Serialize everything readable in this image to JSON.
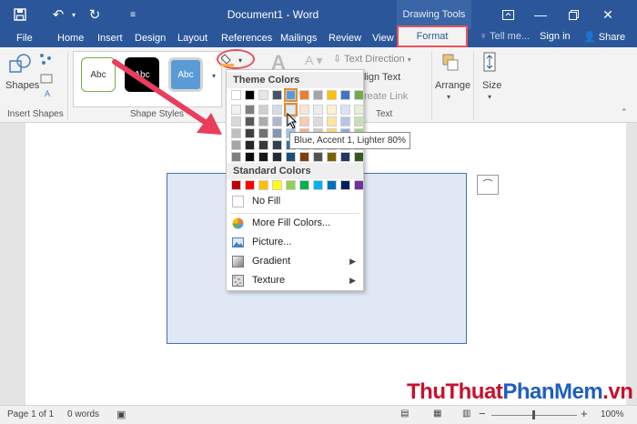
{
  "titlebar": {
    "doc_title": "Document1 - Word",
    "contextual_label": "Drawing Tools"
  },
  "tabs": [
    "File",
    "Home",
    "Insert",
    "Design",
    "Layout",
    "References",
    "Mailings",
    "Review",
    "View"
  ],
  "format_tab": "Format",
  "tell_me": "Tell me...",
  "sign_in": "Sign in",
  "share": "Share",
  "ribbon": {
    "shapes_label": "Shapes",
    "insert_shapes_group": "Insert Shapes",
    "shape_styles_group": "Shape Styles",
    "style_samples": [
      "Abc",
      "Abc",
      "Abc"
    ],
    "text_direction": "Text Direction",
    "align_text": "lign Text",
    "create_link": "reate Link",
    "text_group": "Text",
    "arrange": "Arrange",
    "size": "Size"
  },
  "fill_menu": {
    "theme_colors_header": "Theme Colors",
    "standard_colors_header": "Standard Colors",
    "no_fill": "No Fill",
    "more_fill_colors": "More Fill Colors...",
    "picture": "Picture...",
    "gradient": "Gradient",
    "texture": "Texture",
    "theme_top_row": [
      "#ffffff",
      "#000000",
      "#e7e6e6",
      "#44546a",
      "#5b9bd5",
      "#ed7d31",
      "#a5a5a5",
      "#ffc000",
      "#4472c4",
      "#70ad47"
    ],
    "theme_shades": [
      [
        "#f2f2f2",
        "#7f7f7f",
        "#d0cece",
        "#d6dce4",
        "#deebf6",
        "#fbe5d5",
        "#ededed",
        "#fff2cc",
        "#dae3f3",
        "#e2efd9"
      ],
      [
        "#d8d8d8",
        "#595959",
        "#aeabab",
        "#adb9ca",
        "#bdd7ee",
        "#f7cbac",
        "#dbdbdb",
        "#fee599",
        "#b4c6e7",
        "#c5e0b3"
      ],
      [
        "#bfbfbf",
        "#3f3f3f",
        "#757070",
        "#8496b0",
        "#9cc3e5",
        "#f4b183",
        "#c9c9c9",
        "#ffd965",
        "#8eaadb",
        "#a8d08d"
      ],
      [
        "#a5a5a5",
        "#262626",
        "#3a3838",
        "#323f4f",
        "#2e75b5",
        "#c55a11",
        "#7b7b7b",
        "#bf9000",
        "#2f5496",
        "#538135"
      ],
      [
        "#7f7f7f",
        "#0c0c0c",
        "#171616",
        "#222a35",
        "#1e4e79",
        "#833c0b",
        "#525252",
        "#7f6000",
        "#1f3864",
        "#375623"
      ]
    ],
    "standard_colors": [
      "#c00000",
      "#ff0000",
      "#ffc000",
      "#ffff00",
      "#92d050",
      "#00b050",
      "#00b0f0",
      "#0070c0",
      "#002060",
      "#7030a0"
    ]
  },
  "tooltip": "Blue, Accent 1, Lighter 80%",
  "status": {
    "page": "Page 1 of 1",
    "words": "0 words",
    "zoom": "100%"
  },
  "watermark": {
    "part1": "ThuThuat",
    "part2": "PhanMem",
    "part3": ".vn"
  },
  "colors": {
    "word_blue": "#2b579a",
    "highlight_red": "#e8525a",
    "shape_fill": "#dfe8f4"
  }
}
